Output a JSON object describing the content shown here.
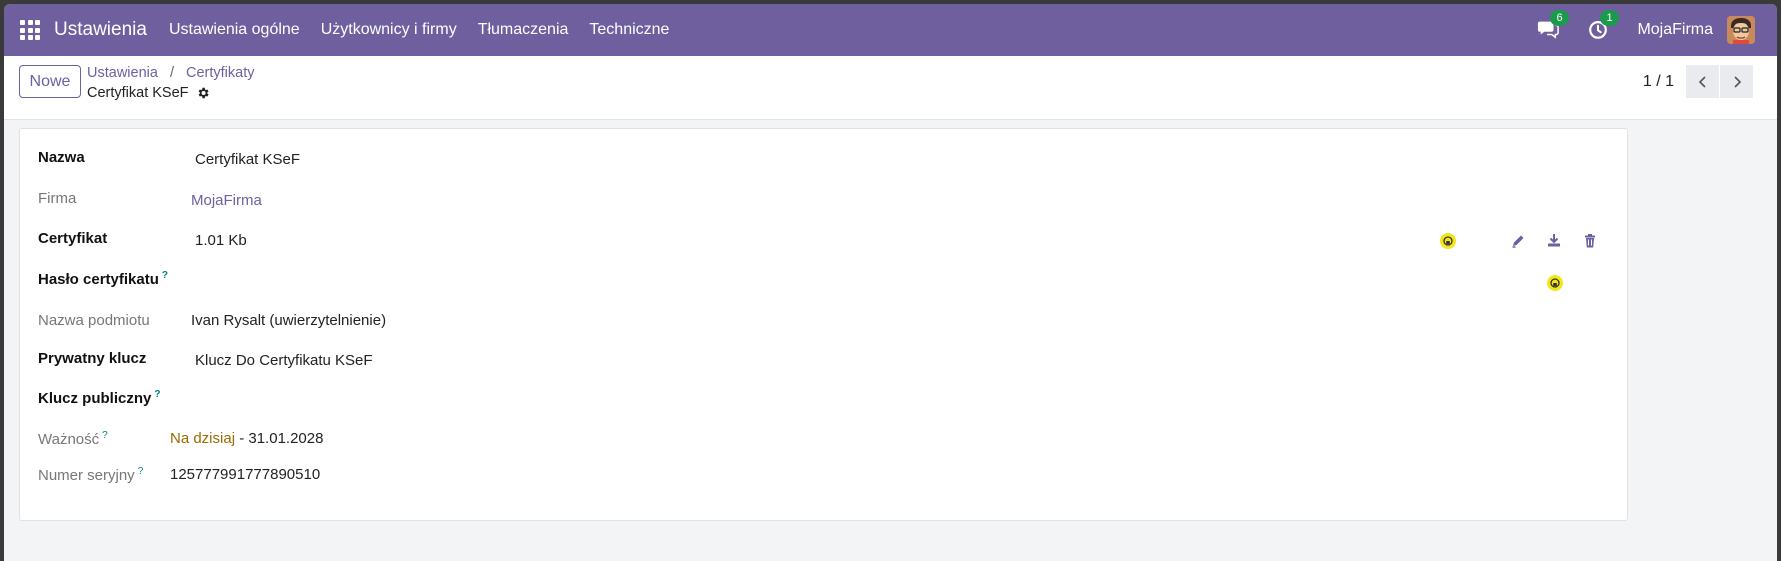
{
  "navbar": {
    "app_title": "Ustawienia",
    "menu": [
      "Ustawienia ogólne",
      "Użytkownicy i firmy",
      "Tłumaczenia",
      "Techniczne"
    ],
    "messages_count": "6",
    "activities_count": "1",
    "company": "MojaFirma",
    "colors": {
      "bar": "#6f5f9e",
      "badge": "#1b9a4b"
    }
  },
  "control": {
    "new_label": "Nowe",
    "breadcrumb": [
      "Ustawienia",
      "Certyfikaty"
    ],
    "breadcrumb_sep": "/",
    "record_title": "Certyfikat KSeF",
    "pager": "1 / 1"
  },
  "form": {
    "name_label": "Nazwa",
    "name_value": "Certyfikat KSeF",
    "company_label": "Firma",
    "company_value": "MojaFirma",
    "cert_label": "Certyfikat",
    "cert_value": "1.01 Kb",
    "password_label": "Hasło certyfikatu",
    "subject_label": "Nazwa podmiotu",
    "subject_value": "Ivan Rysalt (uwierzytelnienie)",
    "private_key_label": "Prywatny klucz",
    "private_key_value": "Klucz Do Certyfikatu KSeF",
    "public_key_label": "Klucz publiczny",
    "validity_label": "Ważność",
    "validity_from": "Na dzisiaj",
    "validity_sep": " - ",
    "validity_to": "31.01.2028",
    "serial_label": "Numer seryjny",
    "serial_value": "125777991777890510",
    "help_mark": "?"
  }
}
